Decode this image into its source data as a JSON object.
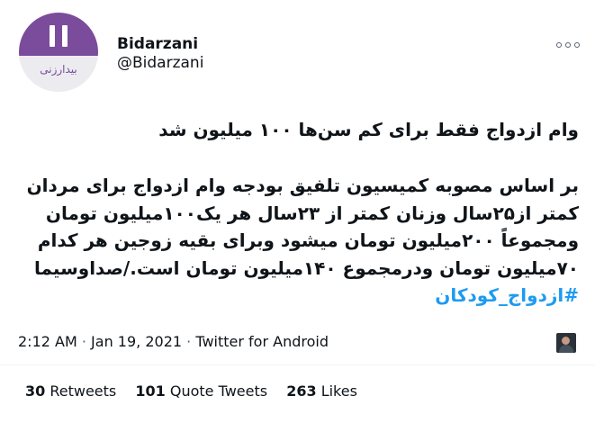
{
  "user": {
    "display_name": "Bidarzani",
    "handle": "@Bidarzani",
    "avatar_text": "بیدارزنی"
  },
  "tweet": {
    "title": "وام ازدواج فقط برای کم سن‌ها ۱۰۰ میلیون شد",
    "body_lines": [
      "بر اساس مصوبه کمیسیون تلفیق بودجه وام ازدواج برای مردان",
      "کمتر از۲۵سال وزنان کمتر از ۲۳سال هر یک۱۰۰میلیون تومان",
      "ومجموعاً ۲۰۰میلیون تومان میشود وبرای بقیه زوجین هر کدام",
      "۷۰میلیون تومان ودرمجموع ۱۴۰میلیون تومان است./صداوسیما"
    ],
    "hashtag": "#ازدواج_کودکان"
  },
  "meta": {
    "time": "2:12 AM",
    "separator": "·",
    "date": "Jan 19, 2021",
    "source": "Twitter for Android"
  },
  "stats": {
    "retweets_count": "30",
    "retweets_label": "Retweets",
    "quotes_count": "101",
    "quotes_label": "Quote Tweets",
    "likes_count": "263",
    "likes_label": "Likes"
  },
  "colors": {
    "accent": "#1d9bf0",
    "avatar_brand": "#7a4c9b",
    "text": "#0f1419",
    "divider": "#eff3f4"
  },
  "icons": {
    "more": "more-options-icon",
    "attached_media": "media-thumbnail"
  }
}
